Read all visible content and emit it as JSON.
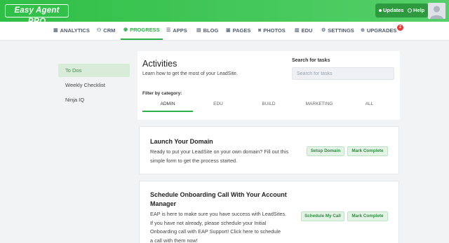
{
  "topbar": {
    "logo_text": "Easy Agent PRO",
    "updates_label": "Updates",
    "help_label": "Help",
    "brand_color": "#2fbf46"
  },
  "nav": {
    "items": [
      {
        "label": "ANALYTICS",
        "icon": "bar-chart-icon",
        "glyph": "▦"
      },
      {
        "label": "CRM",
        "icon": "people-icon",
        "glyph": "⚇"
      },
      {
        "label": "PROGRESS",
        "icon": "progress-icon",
        "glyph": "◉"
      },
      {
        "label": "APPS",
        "icon": "apps-icon",
        "glyph": "☰"
      },
      {
        "label": "BLOG",
        "icon": "blog-icon",
        "glyph": "▤"
      },
      {
        "label": "PAGES",
        "icon": "pages-icon",
        "glyph": "▣"
      },
      {
        "label": "PHOTOS",
        "icon": "camera-icon",
        "glyph": "◙"
      },
      {
        "label": "EDU",
        "icon": "book-icon",
        "glyph": "▥"
      },
      {
        "label": "SETTINGS",
        "icon": "gear-icon",
        "glyph": "⚙"
      },
      {
        "label": "UPGRADES",
        "icon": "upgrade-icon",
        "glyph": "⊕"
      }
    ],
    "active": "PROGRESS",
    "upgrades_badge": "2"
  },
  "sidebar": {
    "items": [
      {
        "label": "To Dos"
      },
      {
        "label": "Weekly Checklist"
      },
      {
        "label": "Ninja IQ"
      }
    ],
    "active": "To Dos"
  },
  "activities": {
    "title": "Activities",
    "subtitle": "Learn how to get the most of your LeadSite.",
    "search_label": "Search for tasks",
    "search_placeholder": "Search for tasks",
    "filter_label": "Filter by category:",
    "tabs": [
      {
        "label": "ADMIN"
      },
      {
        "label": "EDU"
      },
      {
        "label": "BUILD"
      },
      {
        "label": "MARKETING"
      },
      {
        "label": "ALL"
      }
    ],
    "active_tab": "ADMIN"
  },
  "tasks": [
    {
      "title_lines": [
        "Launch Your Domain"
      ],
      "desc_lines": [
        "Ready to put your LeadSite on your own domain? Fill out this",
        "simple form to get the process started."
      ],
      "action_label": "Setup Domain",
      "complete_label": "Mark Complete"
    },
    {
      "title_lines": [
        "Schedule Onboarding Call With Your Account",
        "Manager"
      ],
      "desc_lines": [
        "EAP is here to make sure you have success with LeadSites.",
        "If you have not already, please schedule your Initial",
        "Onboarding call with EAP Support! Click here to schedule",
        "a call with them now!"
      ],
      "action_label": "Schedule My Call",
      "complete_label": "Mark Complete"
    }
  ]
}
